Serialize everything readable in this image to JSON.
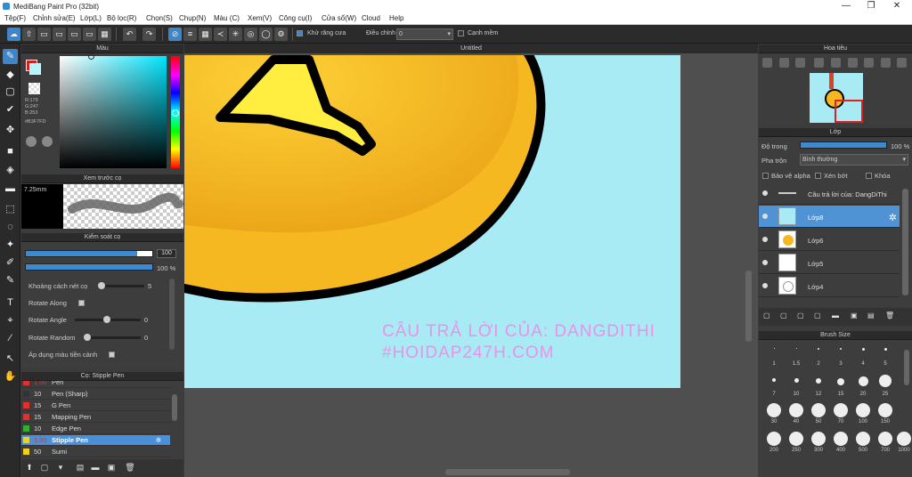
{
  "app": {
    "title": "MediBang Paint Pro (32bit)",
    "min": "—",
    "max": "❐",
    "close": "✕"
  },
  "menu": [
    "Tệp(F)",
    "Chỉnh sửa(E)",
    "Lớp(L)",
    "Bộ lọc(R)",
    "Chọn(S)",
    "Chụp(N)",
    "Màu (C)",
    "Xem(V)",
    "Công cụ(I)",
    "Cửa sổ(W)",
    "Cloud",
    "Help"
  ],
  "toolbar": {
    "antialias": "Khử răng cưa",
    "adjust_label": "Điều chỉnh",
    "adjust_value": "0",
    "sharp": "Cạnh mềm"
  },
  "color_panel": {
    "title": "Màu",
    "r": "R:179",
    "g": "G:247",
    "b": "B:253",
    "hex": "#B3F7FD",
    "main_color": "#b3f7fd"
  },
  "preview_panel": {
    "title": "Xem trước cọ",
    "size": "7.25mm"
  },
  "brush_control": {
    "title": "Kiểm soát cọ",
    "size_value": "100",
    "opacity_value": "100 %",
    "spacing_label": "Khoảng cách nét cọ",
    "spacing_value": "5",
    "rotate_along": "Rotate Along",
    "rotate_angle_label": "Rotate Angle",
    "rotate_angle_value": "0",
    "rotate_random_label": "Rotate Random",
    "rotate_random_value": "0",
    "apply_fg": "Áp dụng màu tiền cảnh"
  },
  "brush_list": {
    "title": "Cọ: Stipple Pen",
    "items": [
      {
        "size": "1.00",
        "name": "Pen",
        "color": "#333333"
      },
      {
        "size": "10",
        "name": "Pen (Sharp)",
        "color": "#333333"
      },
      {
        "size": "15",
        "name": "G Pen",
        "color": "#e03030"
      },
      {
        "size": "15",
        "name": "Mapping Pen",
        "color": "#e03030"
      },
      {
        "size": "10",
        "name": "Edge Pen",
        "color": "#30b030"
      },
      {
        "size": "1.00",
        "name": "Stipple Pen",
        "color": "#f0d020"
      },
      {
        "size": "50",
        "name": "Sumi",
        "color": "#f0d020"
      }
    ]
  },
  "canvas": {
    "title": "Untitled",
    "watermark1": "CÂU TRẢ LỜI CỦA: DANGDITHI",
    "watermark2": "#HOIDAP247H.COM"
  },
  "navigator": {
    "title": "Hoa tiêu"
  },
  "layers_panel": {
    "title": "Lớp",
    "opacity_label": "Độ trong",
    "opacity_value": "100 %",
    "blend_label": "Pha trộn",
    "blend_value": "Bình thường",
    "protect_alpha": "Bảo vệ alpha",
    "clipping": "Xén bớt",
    "lock": "Khóa",
    "layers": [
      {
        "name": "Câu trả lời của: DangDiThi"
      },
      {
        "name": "Lớp8"
      },
      {
        "name": "Lớp6"
      },
      {
        "name": "Lớp5"
      },
      {
        "name": "Lớp4"
      }
    ]
  },
  "brush_size": {
    "title": "Brush Size",
    "sizes": [
      "1",
      "1.5",
      "2",
      "3",
      "4",
      "5",
      "7",
      "10",
      "12",
      "15",
      "20",
      "25",
      "30",
      "40",
      "50",
      "70",
      "100",
      "150",
      "200",
      "250",
      "300",
      "400",
      "500",
      "700",
      "1000"
    ]
  }
}
